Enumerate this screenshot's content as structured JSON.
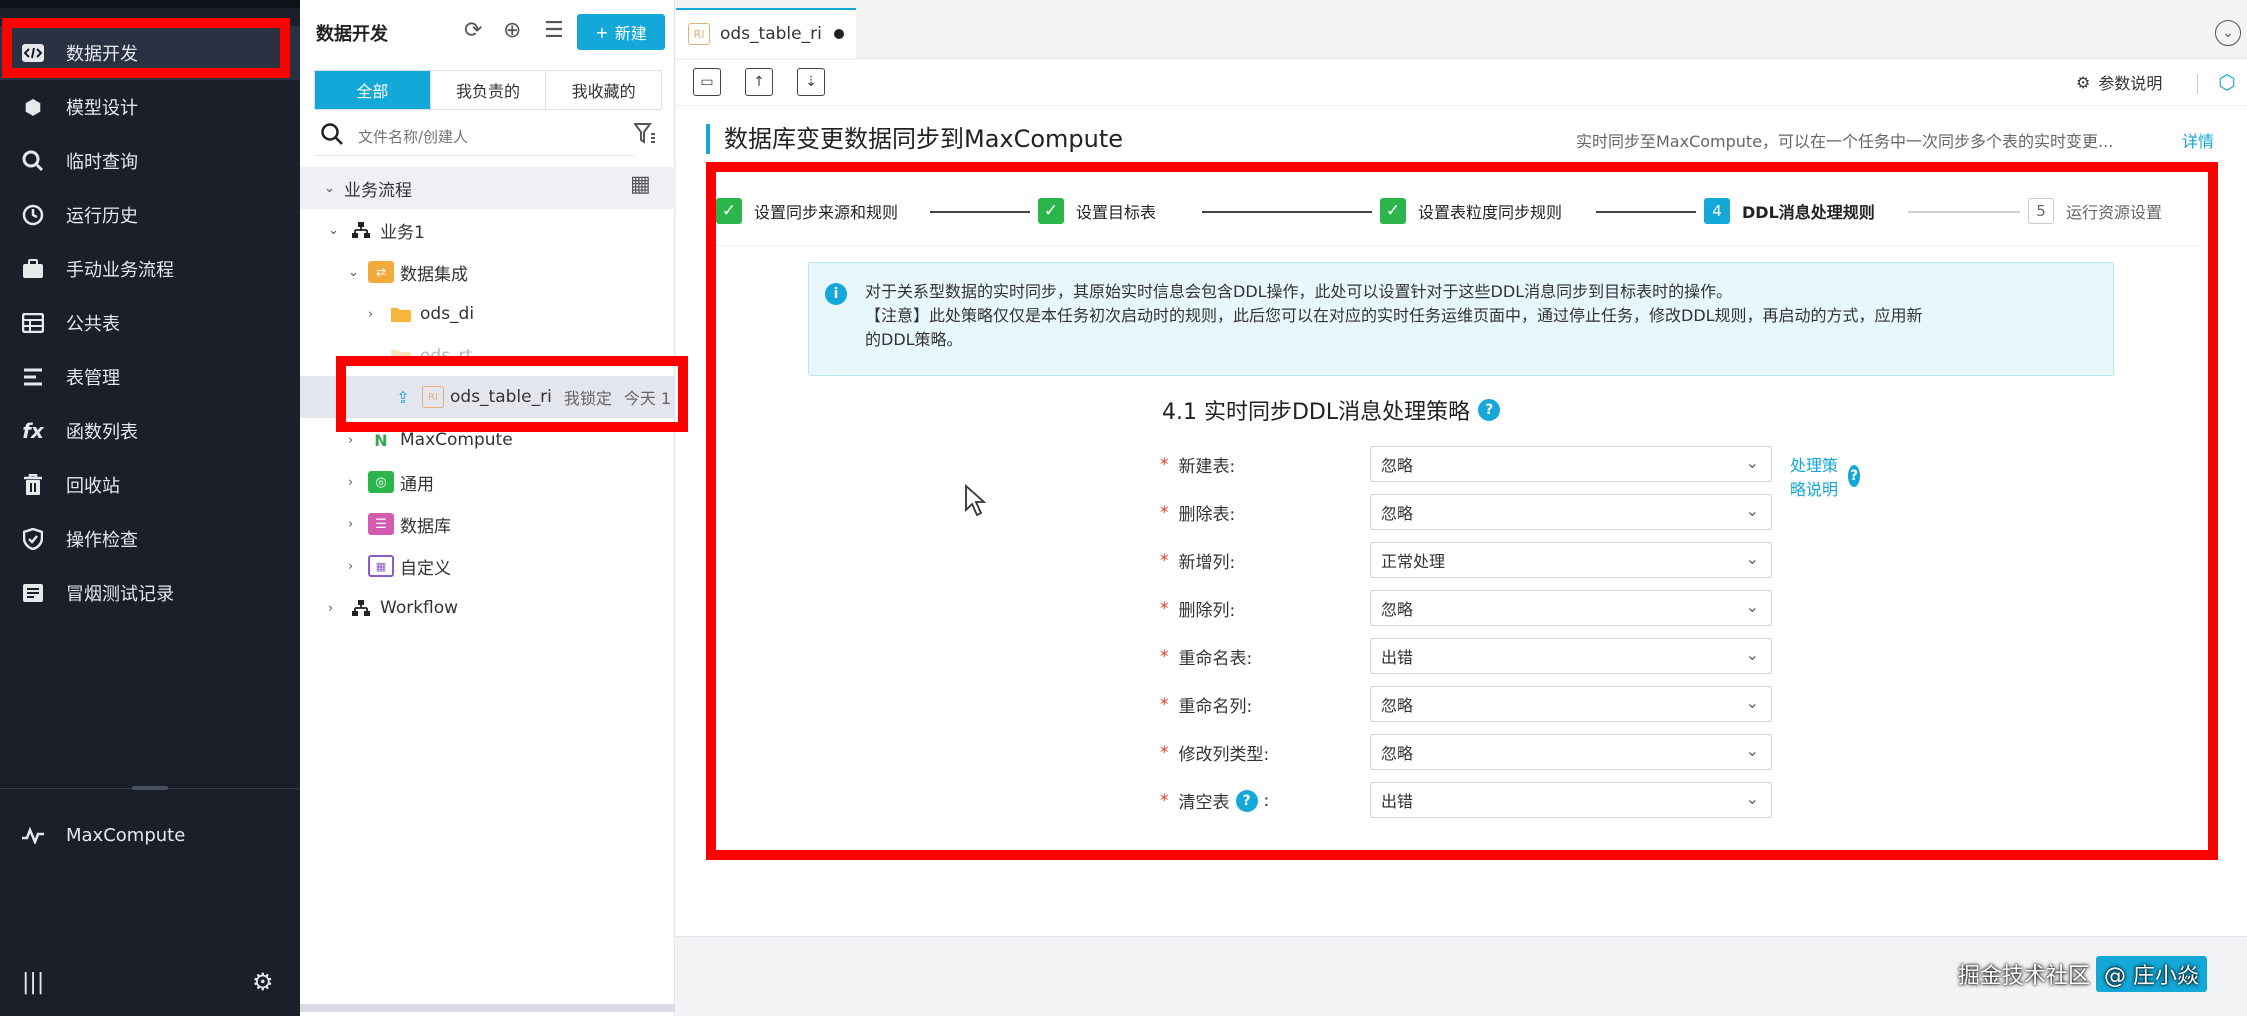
{
  "nav": {
    "items": [
      {
        "label": "数据开发",
        "icon": "code-icon"
      },
      {
        "label": "模型设计",
        "icon": "cube-icon"
      },
      {
        "label": "临时查询",
        "icon": "search-icon"
      },
      {
        "label": "运行历史",
        "icon": "clock-icon"
      },
      {
        "label": "手动业务流程",
        "icon": "briefcase-icon"
      },
      {
        "label": "公共表",
        "icon": "table-icon"
      },
      {
        "label": "表管理",
        "icon": "list-icon"
      },
      {
        "label": "函数列表",
        "icon": "function-icon"
      },
      {
        "label": "回收站",
        "icon": "trash-icon"
      },
      {
        "label": "操作检查",
        "icon": "shield-icon"
      },
      {
        "label": "冒烟测试记录",
        "icon": "log-icon"
      }
    ],
    "engine": "MaxCompute"
  },
  "tree": {
    "title": "数据开发",
    "new_label": "新建",
    "tabs": [
      "全部",
      "我负责的",
      "我收藏的"
    ],
    "search_placeholder": "文件名称/创建人",
    "nodes": {
      "root": "业务流程",
      "biz1": "业务1",
      "integration": "数据集成",
      "ods_di": "ods_di",
      "hidden_folder": "ods_rt",
      "file": "ods_table_ri",
      "file_lock": "我锁定",
      "file_time": "今天 1",
      "maxcompute": "MaxCompute",
      "general": "通用",
      "database": "数据库",
      "custom": "自定义",
      "workflow": "Workflow"
    }
  },
  "tab": {
    "label": "ods_table_ri",
    "icon_text": "RI"
  },
  "toolbar": {
    "param_label": "参数说明"
  },
  "page": {
    "title": "数据库变更数据同步到MaxCompute",
    "desc": "实时同步至MaxCompute，可以在一个任务中一次同步多个表的实时变更...",
    "detail_link": "详情"
  },
  "steps": [
    {
      "label": "设置同步来源和规则",
      "state": "done"
    },
    {
      "label": "设置目标表",
      "state": "done"
    },
    {
      "label": "设置表粒度同步规则",
      "state": "done"
    },
    {
      "label": "DDL消息处理规则",
      "state": "current",
      "num": "4"
    },
    {
      "label": "运行资源设置",
      "state": "todo",
      "num": "5"
    }
  ],
  "notice": {
    "line1": "对于关系型数据的实时同步，其原始实时信息会包含DDL操作，此处可以设置针对于这些DDL消息同步到目标表时的操作。",
    "line2": "【注意】此处策略仅仅是本任务初次启动时的规则，此后您可以在对应的实时任务运维页面中，通过停止任务，修改DDL规则，再启动的方式，应用新",
    "line3": "的DDL策略。"
  },
  "section": {
    "title": "4.1 实时同步DDL消息处理策略"
  },
  "form": {
    "help_link": "处理策略说明",
    "rows": [
      {
        "label": "新建表:",
        "value": "忽略"
      },
      {
        "label": "删除表:",
        "value": "忽略"
      },
      {
        "label": "新增列:",
        "value": "正常处理"
      },
      {
        "label": "删除列:",
        "value": "忽略"
      },
      {
        "label": "重命名表:",
        "value": "出错"
      },
      {
        "label": "重命名列:",
        "value": "忽略"
      },
      {
        "label": "修改列类型:",
        "value": "忽略"
      },
      {
        "label": "清空表",
        "value": "出错",
        "label_suffix": ":"
      }
    ]
  },
  "watermark": {
    "site": "掘金技术社区",
    "author": "@ 庄小焱"
  },
  "colors": {
    "accent": "#13a8d8",
    "highlight": "#ff0000",
    "nav_bg": "#1b1f29",
    "done": "#2bb54a"
  }
}
